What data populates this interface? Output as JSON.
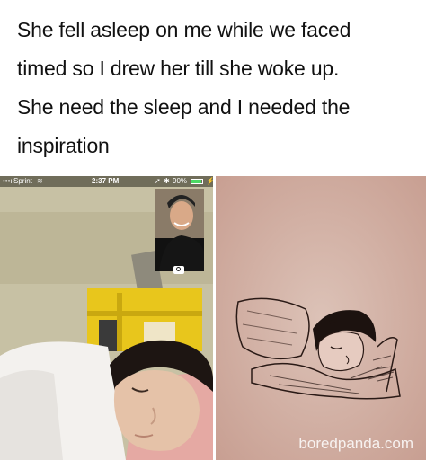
{
  "caption": {
    "lines": [
      "She fell asleep on me while we faced",
      "timed so I drew her till she woke up.",
      "She need the sleep and I needed the",
      "inspiration"
    ]
  },
  "phone_status": {
    "carrier": "Sprint",
    "time": "2:37 PM",
    "battery": "90%"
  },
  "icons": [
    "wifi-icon",
    "location-icon",
    "bluetooth-icon",
    "battery-icon",
    "camera-switch-icon"
  ],
  "colors": {
    "battery": "#4cd964",
    "sketch_bg": "#d6b9ae"
  },
  "watermark": "boredpanda.com"
}
